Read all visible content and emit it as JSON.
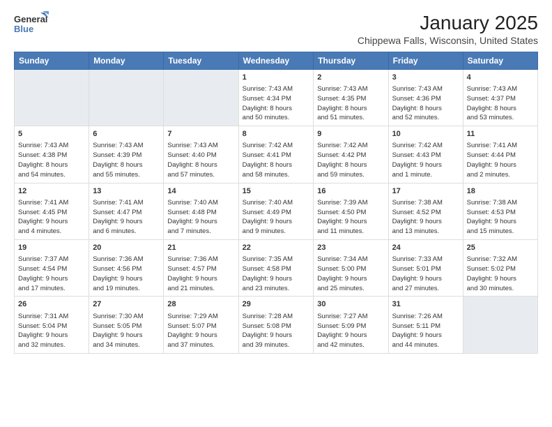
{
  "header": {
    "logo_general": "General",
    "logo_blue": "Blue",
    "title": "January 2025",
    "subtitle": "Chippewa Falls, Wisconsin, United States"
  },
  "weekdays": [
    "Sunday",
    "Monday",
    "Tuesday",
    "Wednesday",
    "Thursday",
    "Friday",
    "Saturday"
  ],
  "weeks": [
    [
      {
        "day": "",
        "info": ""
      },
      {
        "day": "",
        "info": ""
      },
      {
        "day": "",
        "info": ""
      },
      {
        "day": "1",
        "info": "Sunrise: 7:43 AM\nSunset: 4:34 PM\nDaylight: 8 hours\nand 50 minutes."
      },
      {
        "day": "2",
        "info": "Sunrise: 7:43 AM\nSunset: 4:35 PM\nDaylight: 8 hours\nand 51 minutes."
      },
      {
        "day": "3",
        "info": "Sunrise: 7:43 AM\nSunset: 4:36 PM\nDaylight: 8 hours\nand 52 minutes."
      },
      {
        "day": "4",
        "info": "Sunrise: 7:43 AM\nSunset: 4:37 PM\nDaylight: 8 hours\nand 53 minutes."
      }
    ],
    [
      {
        "day": "5",
        "info": "Sunrise: 7:43 AM\nSunset: 4:38 PM\nDaylight: 8 hours\nand 54 minutes."
      },
      {
        "day": "6",
        "info": "Sunrise: 7:43 AM\nSunset: 4:39 PM\nDaylight: 8 hours\nand 55 minutes."
      },
      {
        "day": "7",
        "info": "Sunrise: 7:43 AM\nSunset: 4:40 PM\nDaylight: 8 hours\nand 57 minutes."
      },
      {
        "day": "8",
        "info": "Sunrise: 7:42 AM\nSunset: 4:41 PM\nDaylight: 8 hours\nand 58 minutes."
      },
      {
        "day": "9",
        "info": "Sunrise: 7:42 AM\nSunset: 4:42 PM\nDaylight: 8 hours\nand 59 minutes."
      },
      {
        "day": "10",
        "info": "Sunrise: 7:42 AM\nSunset: 4:43 PM\nDaylight: 9 hours\nand 1 minute."
      },
      {
        "day": "11",
        "info": "Sunrise: 7:41 AM\nSunset: 4:44 PM\nDaylight: 9 hours\nand 2 minutes."
      }
    ],
    [
      {
        "day": "12",
        "info": "Sunrise: 7:41 AM\nSunset: 4:45 PM\nDaylight: 9 hours\nand 4 minutes."
      },
      {
        "day": "13",
        "info": "Sunrise: 7:41 AM\nSunset: 4:47 PM\nDaylight: 9 hours\nand 6 minutes."
      },
      {
        "day": "14",
        "info": "Sunrise: 7:40 AM\nSunset: 4:48 PM\nDaylight: 9 hours\nand 7 minutes."
      },
      {
        "day": "15",
        "info": "Sunrise: 7:40 AM\nSunset: 4:49 PM\nDaylight: 9 hours\nand 9 minutes."
      },
      {
        "day": "16",
        "info": "Sunrise: 7:39 AM\nSunset: 4:50 PM\nDaylight: 9 hours\nand 11 minutes."
      },
      {
        "day": "17",
        "info": "Sunrise: 7:38 AM\nSunset: 4:52 PM\nDaylight: 9 hours\nand 13 minutes."
      },
      {
        "day": "18",
        "info": "Sunrise: 7:38 AM\nSunset: 4:53 PM\nDaylight: 9 hours\nand 15 minutes."
      }
    ],
    [
      {
        "day": "19",
        "info": "Sunrise: 7:37 AM\nSunset: 4:54 PM\nDaylight: 9 hours\nand 17 minutes."
      },
      {
        "day": "20",
        "info": "Sunrise: 7:36 AM\nSunset: 4:56 PM\nDaylight: 9 hours\nand 19 minutes."
      },
      {
        "day": "21",
        "info": "Sunrise: 7:36 AM\nSunset: 4:57 PM\nDaylight: 9 hours\nand 21 minutes."
      },
      {
        "day": "22",
        "info": "Sunrise: 7:35 AM\nSunset: 4:58 PM\nDaylight: 9 hours\nand 23 minutes."
      },
      {
        "day": "23",
        "info": "Sunrise: 7:34 AM\nSunset: 5:00 PM\nDaylight: 9 hours\nand 25 minutes."
      },
      {
        "day": "24",
        "info": "Sunrise: 7:33 AM\nSunset: 5:01 PM\nDaylight: 9 hours\nand 27 minutes."
      },
      {
        "day": "25",
        "info": "Sunrise: 7:32 AM\nSunset: 5:02 PM\nDaylight: 9 hours\nand 30 minutes."
      }
    ],
    [
      {
        "day": "26",
        "info": "Sunrise: 7:31 AM\nSunset: 5:04 PM\nDaylight: 9 hours\nand 32 minutes."
      },
      {
        "day": "27",
        "info": "Sunrise: 7:30 AM\nSunset: 5:05 PM\nDaylight: 9 hours\nand 34 minutes."
      },
      {
        "day": "28",
        "info": "Sunrise: 7:29 AM\nSunset: 5:07 PM\nDaylight: 9 hours\nand 37 minutes."
      },
      {
        "day": "29",
        "info": "Sunrise: 7:28 AM\nSunset: 5:08 PM\nDaylight: 9 hours\nand 39 minutes."
      },
      {
        "day": "30",
        "info": "Sunrise: 7:27 AM\nSunset: 5:09 PM\nDaylight: 9 hours\nand 42 minutes."
      },
      {
        "day": "31",
        "info": "Sunrise: 7:26 AM\nSunset: 5:11 PM\nDaylight: 9 hours\nand 44 minutes."
      },
      {
        "day": "",
        "info": ""
      }
    ]
  ]
}
